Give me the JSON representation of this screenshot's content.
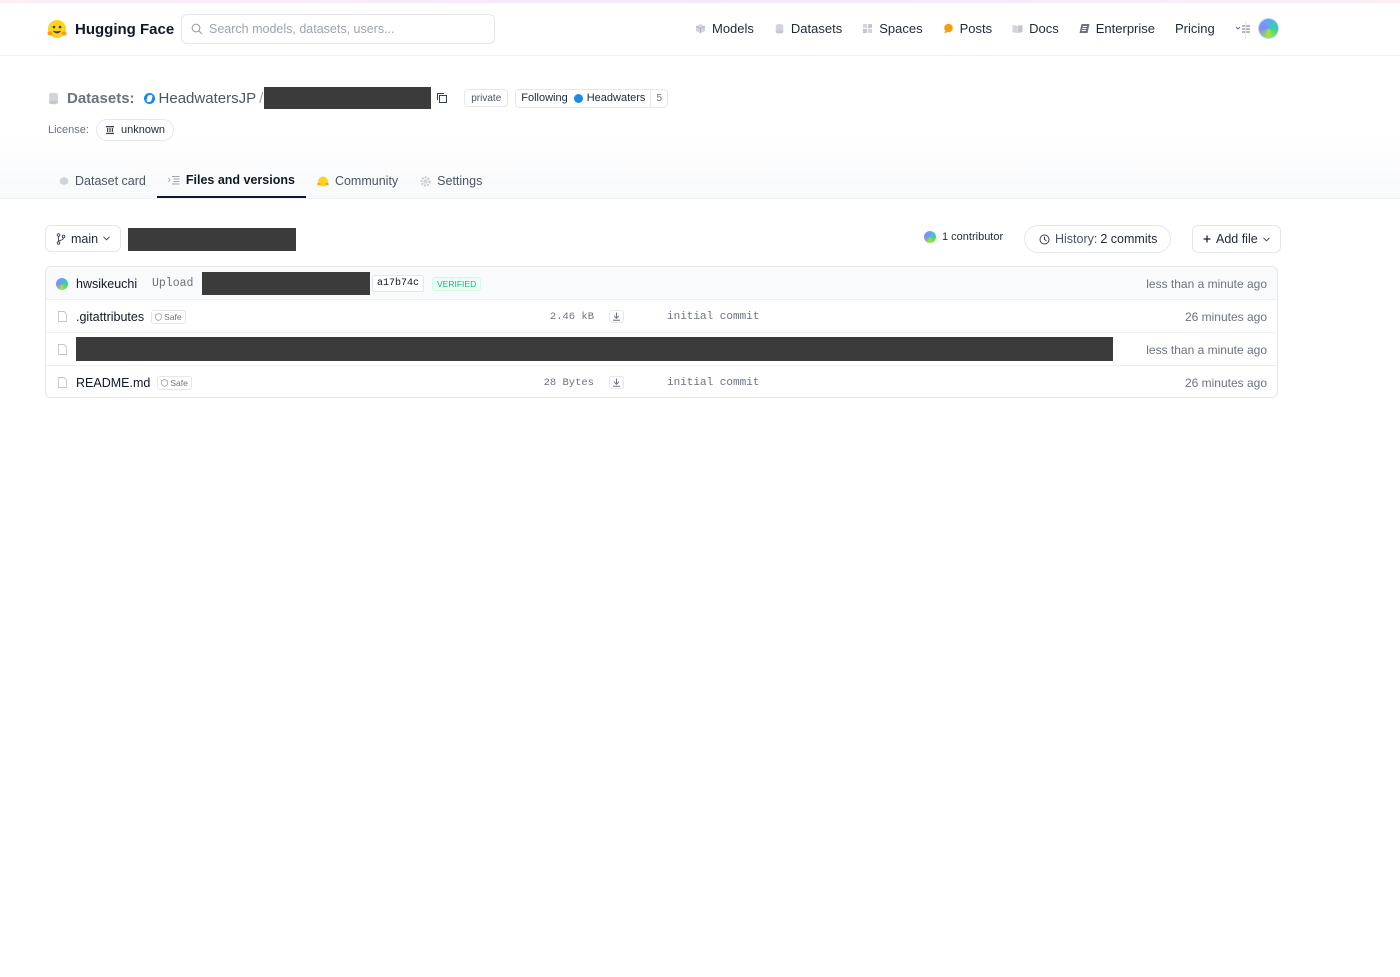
{
  "brand": {
    "name": "Hugging Face"
  },
  "search": {
    "placeholder": "Search models, datasets, users..."
  },
  "nav": {
    "items": [
      {
        "label": "Models",
        "icon": "cube-icon"
      },
      {
        "label": "Datasets",
        "icon": "database-icon"
      },
      {
        "label": "Spaces",
        "icon": "grid-icon"
      },
      {
        "label": "Posts",
        "icon": "chat-bubble-icon"
      },
      {
        "label": "Docs",
        "icon": "book-icon"
      },
      {
        "label": "Enterprise",
        "icon": "enterprise-icon"
      },
      {
        "label": "Pricing",
        "icon": ""
      }
    ]
  },
  "repo": {
    "type_label": "Datasets:",
    "owner": "HeadwatersJP",
    "slash": "/",
    "visibility": "private",
    "follow_label": "Following",
    "follow_org": "Headwaters",
    "follow_count": "5",
    "license_label": "License:",
    "license_value": "unknown"
  },
  "tabs": [
    {
      "label": "Dataset card",
      "icon": "cube-icon",
      "active": false
    },
    {
      "label": "Files and versions",
      "icon": "files-icon",
      "active": true
    },
    {
      "label": "Community",
      "icon": "emoji-icon",
      "active": false
    },
    {
      "label": "Settings",
      "icon": "gear-icon",
      "active": false
    }
  ],
  "toolbar": {
    "branch": "main",
    "contributors": "1 contributor",
    "history_prefix": "History:",
    "history_count": "2 commits",
    "add_file": "Add file"
  },
  "last_commit": {
    "author": "hwsikeuchi",
    "message": "Upload",
    "hash": "a17b74c",
    "verified": "VERIFIED",
    "time": "less than a minute ago"
  },
  "files": [
    {
      "name": ".gitattributes",
      "safe": "Safe",
      "size": "2.46 kB",
      "commit": "initial commit",
      "time": "26 minutes ago",
      "redacted": false
    },
    {
      "name": "",
      "safe": "",
      "size": "",
      "commit": "",
      "time": "less than a minute ago",
      "redacted": true
    },
    {
      "name": "README.md",
      "safe": "Safe",
      "size": "28 Bytes",
      "commit": "initial commit",
      "time": "26 minutes ago",
      "redacted": false
    }
  ],
  "colors": {
    "accent": "#111827",
    "verified": "#10b981",
    "org_blue": "#1e88e5",
    "redaction": "#3b3b3b"
  }
}
